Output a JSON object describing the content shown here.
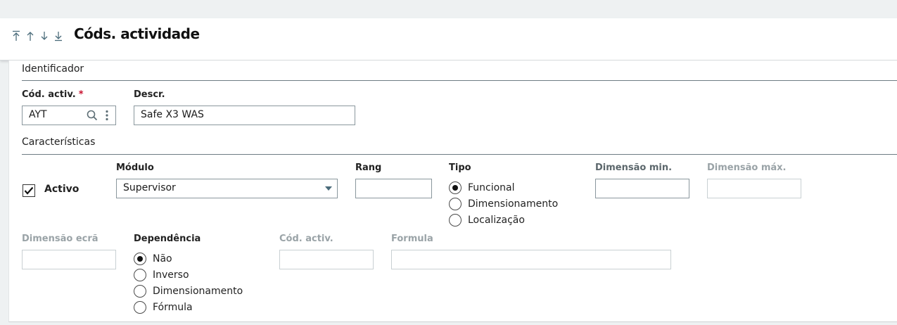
{
  "header": {
    "title": "Códs. actividade"
  },
  "nav": {
    "first_icon": "arrow-to-top-icon",
    "prev_icon": "arrow-up-icon",
    "next_icon": "arrow-down-icon",
    "last_icon": "arrow-to-bottom-icon"
  },
  "identificador": {
    "section_title": "Identificador",
    "cod_activ_label": "Cód. activ.",
    "required_mark": "*",
    "cod_activ_value": "AYT",
    "descr_label": "Descr.",
    "descr_value": "Safe X3 WAS"
  },
  "caracteristicas": {
    "section_title": "Características",
    "activo_label": "Activo",
    "activo_checked": true,
    "modulo_label": "Módulo",
    "modulo_value": "Supervisor",
    "rang_label": "Rang",
    "rang_value": "",
    "tipo_label": "Tipo",
    "tipo_options": [
      "Funcional",
      "Dimensionamento",
      "Localização"
    ],
    "tipo_selected": "Funcional",
    "dim_min_label": "Dimensão min.",
    "dim_max_label": "Dimensão máx.",
    "dim_ecra_label": "Dimensão ecrã",
    "dependencia_label": "Dependência",
    "dependencia_options": [
      "Não",
      "Inverso",
      "Dimensionamento",
      "Fórmula"
    ],
    "dependencia_selected": "Não",
    "cod_activ2_label": "Cód. activ.",
    "formula_label": "Formula"
  },
  "colors": {
    "accent": "#4a6b7a",
    "required": "#c8102e",
    "disabled_text": "#9aa3a7"
  }
}
